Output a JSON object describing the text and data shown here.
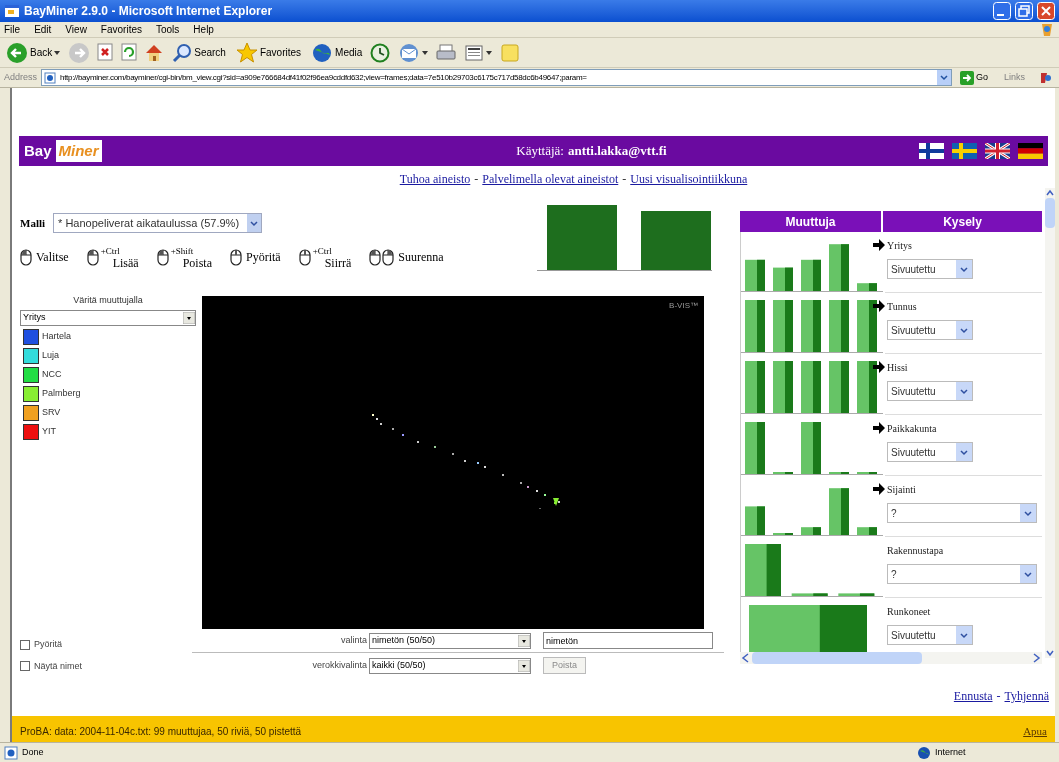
{
  "window": {
    "title": "BayMiner 2.9.0 - Microsoft Internet Explorer"
  },
  "menu": [
    "File",
    "Edit",
    "View",
    "Favorites",
    "Tools",
    "Help"
  ],
  "toolbar": [
    {
      "kind": "back",
      "label": "Back"
    },
    {
      "kind": "forward"
    },
    {
      "kind": "stop"
    },
    {
      "kind": "refresh"
    },
    {
      "kind": "home"
    },
    {
      "kind": "search",
      "label": "Search"
    },
    {
      "kind": "favorites",
      "label": "Favorites"
    },
    {
      "kind": "media",
      "label": "Media"
    },
    {
      "kind": "history"
    },
    {
      "kind": "mail"
    },
    {
      "kind": "print"
    },
    {
      "kind": "edit"
    },
    {
      "kind": "notes"
    }
  ],
  "address": {
    "label": "Address",
    "url": "http://bayminer.com/bayminer/cgi-bin/bm_view.cgi?sid=a909e766684df41f02f96ea9cddfd632;view=frames;data=7e510b29703c6175c717d58dc6b49647;param=",
    "go": "Go",
    "links": "Links"
  },
  "header": {
    "logo_left": "Bay",
    "logo_right": "Miner",
    "user_label": "Käyttäjä:",
    "user": "antti.lakka@vtt.fi"
  },
  "links": {
    "separator": "-",
    "items": [
      "Tuhoa aineisto",
      "Palvelimella olevat aineistot",
      "Uusi visualisointiikkuna"
    ]
  },
  "model": {
    "label": "Malli",
    "value": "* Hanopeliverat aikataulussa (57.9%)"
  },
  "mouse_tools": [
    {
      "label": "Valitse",
      "kind": "left"
    },
    {
      "label": "Lisää",
      "modifier": "+Ctrl",
      "kind": "left"
    },
    {
      "label": "Poista",
      "modifier": "+Shift",
      "kind": "left"
    },
    {
      "label": "Pyöritä",
      "kind": "middle"
    },
    {
      "label": "Siirrä",
      "modifier": "+Ctrl",
      "kind": "middle"
    },
    {
      "label": "Suurenna",
      "kind": "both"
    }
  ],
  "color_by": {
    "label": "Väritä muuttujalla",
    "value": "Yritys",
    "items": [
      {
        "label": "Hartela",
        "color": "#1f4fe0"
      },
      {
        "label": "Luja",
        "color": "#33dcdc"
      },
      {
        "label": "NCC",
        "color": "#22dd44"
      },
      {
        "label": "Palmberg",
        "color": "#88ee33"
      },
      {
        "label": "SRV",
        "color": "#f0a020"
      },
      {
        "label": "YIT",
        "color": "#ee1010"
      }
    ]
  },
  "canvas": {
    "brand": "B-VIS™"
  },
  "variables_panel": {
    "columns": [
      "Muuttuja",
      "Kysely"
    ],
    "rows": [
      {
        "name": "Yritys",
        "query": "Sivuutettu",
        "arrow": true
      },
      {
        "name": "Tunnus",
        "query": "Sivuutettu",
        "arrow": true
      },
      {
        "name": "Hissi",
        "query": "Sivuutettu",
        "arrow": true
      },
      {
        "name": "Paikkakunta",
        "query": "Sivuutettu",
        "arrow": true
      },
      {
        "name": "Sijainti",
        "query": "?",
        "arrow": true
      },
      {
        "name": "Rakennustapa",
        "query": "?",
        "arrow": false
      },
      {
        "name": "Runkoneet",
        "query": "Sivuutettu",
        "arrow": false
      }
    ]
  },
  "selection": {
    "label": "valinta",
    "value": "nimetön (50/50)",
    "name": "nimetön"
  },
  "compare": {
    "label": "verokkivalinta",
    "value": "kaikki (50/50)",
    "button": "Poista",
    "disabled": true
  },
  "checkboxes": [
    {
      "label": "Pyöritä",
      "checked": false
    },
    {
      "label": "Näytä nimet",
      "checked": false
    }
  ],
  "actions": {
    "separator": "-",
    "items": [
      "Ennusta",
      "Tyhjennä"
    ]
  },
  "status": {
    "text": "ProBA: data: 2004-11-04c.txt: 99 muuttujaa, 50 riviä, 50 pistettä",
    "help": "Apua"
  },
  "ie_status": {
    "text": "Done",
    "zone": "Internet"
  }
}
